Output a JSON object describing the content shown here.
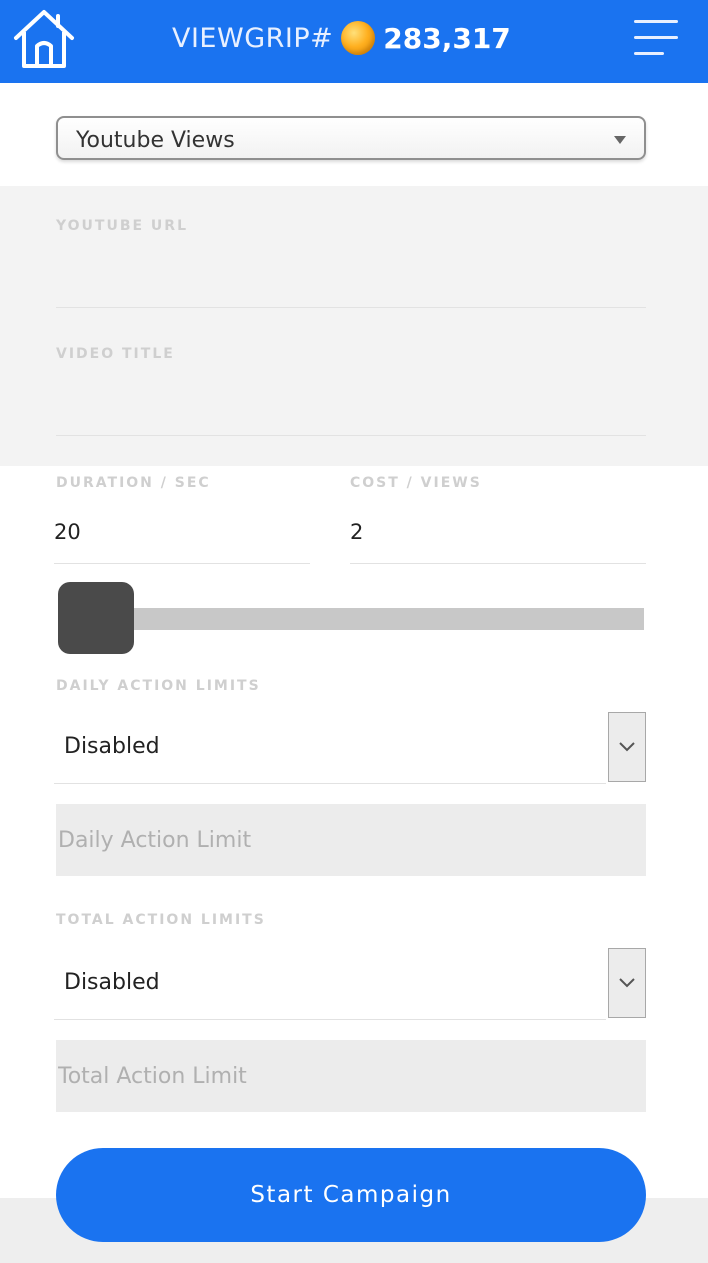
{
  "header": {
    "brand_name": "VIEWGRIP#",
    "coin_count": "283,317",
    "home_icon": "home-icon",
    "menu_icon": "hamburger-menu-icon",
    "coin_icon": "gold-coin-icon"
  },
  "service": {
    "selected": "Youtube Views"
  },
  "fields": {
    "youtube_url": {
      "label": "YOUTUBE URL",
      "value": ""
    },
    "video_title": {
      "label": "VIDEO TITLE",
      "value": ""
    },
    "duration": {
      "label": "DURATION / SEC",
      "value": "20"
    },
    "cost": {
      "label": "COST / VIEWS",
      "value": "2"
    }
  },
  "slider": {
    "level": 0
  },
  "daily_limits": {
    "label": "DAILY ACTION LIMITS",
    "selected": "Disabled",
    "placeholder": "Daily Action Limit"
  },
  "total_limits": {
    "label": "TOTAL ACTION LIMITS",
    "selected": "Disabled",
    "placeholder": "Total Action Limit"
  },
  "actions": {
    "start_label": "Start Campaign"
  },
  "colors": {
    "primary": "#1a73f0",
    "slider_thumb": "#4a4a4a"
  }
}
